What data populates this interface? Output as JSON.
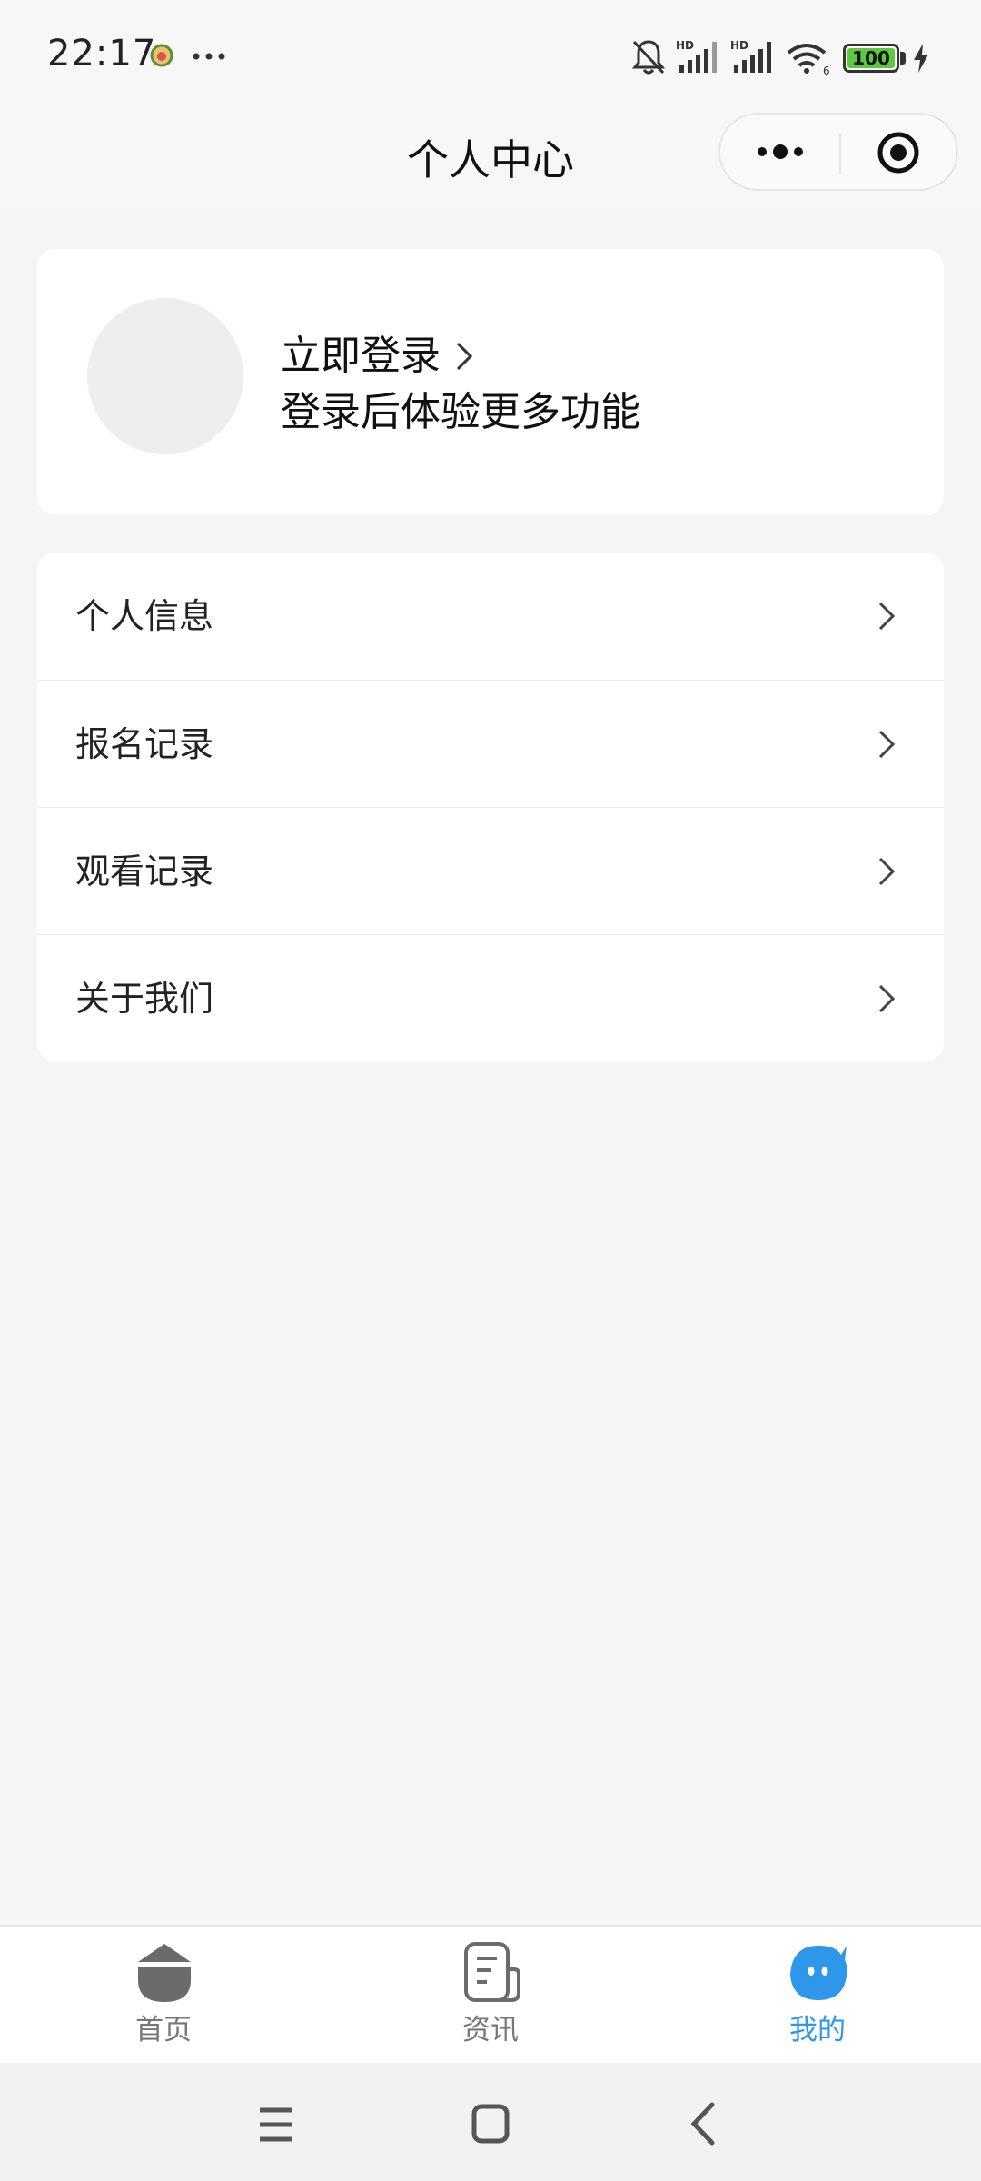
{
  "status_bar": {
    "time": "22:17",
    "battery": "100",
    "icons": [
      "app-icon",
      "more-dots-icon",
      "mute-bell-icon",
      "hd-signal-icon",
      "hd-signal-icon",
      "wifi-icon",
      "battery-icon",
      "charging-icon"
    ]
  },
  "nav": {
    "title": "个人中心",
    "capsule": {
      "more_icon": "more-dots-icon",
      "close_icon": "target-close-icon"
    }
  },
  "login_card": {
    "login_label": "立即登录",
    "subtitle": "登录后体验更多功能"
  },
  "menu": {
    "items": [
      {
        "label": "个人信息"
      },
      {
        "label": "报名记录"
      },
      {
        "label": "观看记录"
      },
      {
        "label": "关于我们"
      }
    ]
  },
  "tab_bar": {
    "active_color": "#2e97ea",
    "inactive_color": "#777777",
    "tabs": [
      {
        "label": "首页",
        "icon": "home-icon",
        "active": false
      },
      {
        "label": "资讯",
        "icon": "news-icon",
        "active": false
      },
      {
        "label": "我的",
        "icon": "profile-face-icon",
        "active": true
      }
    ]
  },
  "system_nav": {
    "icons": [
      "menu-icon",
      "home-square-icon",
      "back-icon"
    ]
  }
}
